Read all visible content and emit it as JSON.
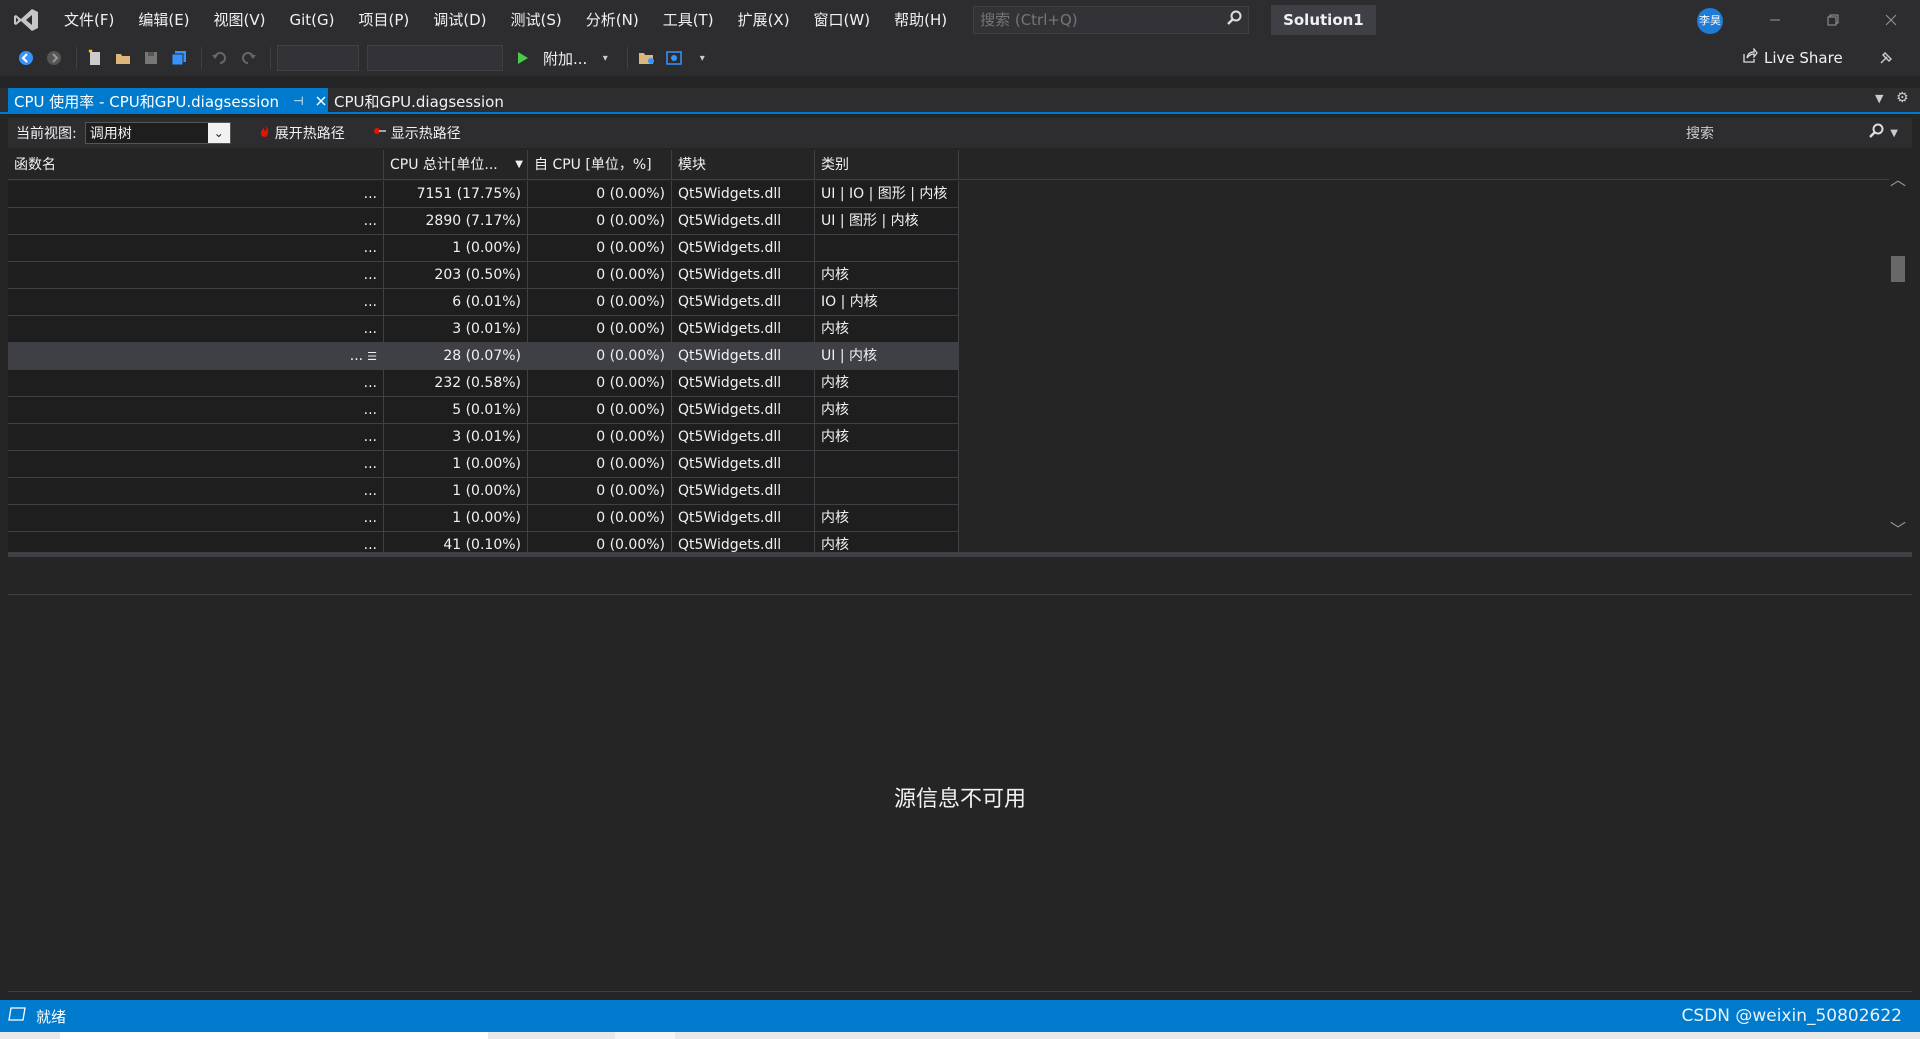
{
  "menu": {
    "items": [
      "文件(F)",
      "编辑(E)",
      "视图(V)",
      "Git(G)",
      "项目(P)",
      "调试(D)",
      "测试(S)",
      "分析(N)",
      "工具(T)",
      "扩展(X)",
      "窗口(W)",
      "帮助(H)"
    ],
    "search_placeholder": "搜索 (Ctrl+Q)",
    "solution_title": "Solution1",
    "avatar_initials": "李昊"
  },
  "toolbar": {
    "attach_label": "附加...",
    "live_share_label": "Live Share"
  },
  "tabs": {
    "active_label": "CPU 使用率 - CPU和GPU.diagsession",
    "inactive_label": "CPU和GPU.diagsession"
  },
  "view_bar": {
    "current_view_label": "当前视图:",
    "current_view_value": "调用树",
    "expand_hot_path_label": "展开热路径",
    "show_hot_path_label": "显示热路径",
    "search_placeholder": "搜索"
  },
  "grid": {
    "columns": [
      "函数名",
      "CPU 总计[单位...",
      "自 CPU [单位，%]",
      "模块",
      "类别"
    ],
    "rows": [
      {
        "name": "...",
        "total": "7151 (17.75%)",
        "self": "0 (0.00%)",
        "module": "Qt5Widgets.dll",
        "category": "UI | IO | 图形 | 内核"
      },
      {
        "name": "...",
        "total": "2890 (7.17%)",
        "self": "0 (0.00%)",
        "module": "Qt5Widgets.dll",
        "category": "UI | 图形 | 内核"
      },
      {
        "name": "...",
        "total": "1 (0.00%)",
        "self": "0 (0.00%)",
        "module": "Qt5Widgets.dll",
        "category": ""
      },
      {
        "name": "...",
        "total": "203 (0.50%)",
        "self": "0 (0.00%)",
        "module": "Qt5Widgets.dll",
        "category": "内核"
      },
      {
        "name": "...",
        "total": "6 (0.01%)",
        "self": "0 (0.00%)",
        "module": "Qt5Widgets.dll",
        "category": "IO | 内核"
      },
      {
        "name": "...",
        "total": "3 (0.01%)",
        "self": "0 (0.00%)",
        "module": "Qt5Widgets.dll",
        "category": "内核"
      },
      {
        "name": "...",
        "total": "28 (0.07%)",
        "self": "0 (0.00%)",
        "module": "Qt5Widgets.dll",
        "category": "UI | 内核",
        "selected": true
      },
      {
        "name": "...",
        "total": "232 (0.58%)",
        "self": "0 (0.00%)",
        "module": "Qt5Widgets.dll",
        "category": "内核"
      },
      {
        "name": "...",
        "total": "5 (0.01%)",
        "self": "0 (0.00%)",
        "module": "Qt5Widgets.dll",
        "category": "内核"
      },
      {
        "name": "...",
        "total": "3 (0.01%)",
        "self": "0 (0.00%)",
        "module": "Qt5Widgets.dll",
        "category": "内核"
      },
      {
        "name": "...",
        "total": "1 (0.00%)",
        "self": "0 (0.00%)",
        "module": "Qt5Widgets.dll",
        "category": ""
      },
      {
        "name": "...",
        "total": "1 (0.00%)",
        "self": "0 (0.00%)",
        "module": "Qt5Widgets.dll",
        "category": ""
      },
      {
        "name": "...",
        "total": "1 (0.00%)",
        "self": "0 (0.00%)",
        "module": "Qt5Widgets.dll",
        "category": "内核"
      },
      {
        "name": "...",
        "total": "41 (0.10%)",
        "self": "0 (0.00%)",
        "module": "Qt5Widgets.dll",
        "category": "内核"
      }
    ]
  },
  "source_panel": {
    "message": "源信息不可用"
  },
  "statusbar": {
    "status_text": "就绪",
    "watermark": "CSDN @weixin_50802622"
  },
  "colors": {
    "accent": "#007acc",
    "background": "#252526",
    "chrome": "#2d2d30"
  }
}
